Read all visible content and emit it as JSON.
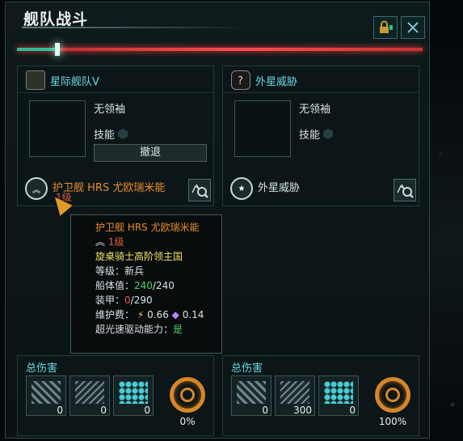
{
  "window": {
    "title": "舰队战斗"
  },
  "battle": {
    "progress_split": 0.1
  },
  "left": {
    "fleet_name": "星际舰队V",
    "leader": "无领袖",
    "skill_label": "技能",
    "retreat_label": "撤退",
    "ship_name": "护卫舰 HRS 尤欧瑞米能",
    "ship_level": "1级"
  },
  "right": {
    "fleet_name": "外星威胁",
    "leader": "无领袖",
    "skill_label": "技能",
    "ship_name": "外星威胁"
  },
  "tooltip": {
    "title": "护卫舰 HRS 尤欧瑞米能",
    "level": "1级",
    "empire": "旋桌骑士高阶领主国",
    "rank_label": "等级：",
    "rank_value": "新兵",
    "hull_label": "船体值：",
    "hull_current": "240",
    "hull_max": "/240",
    "armor_label": "装甲：",
    "armor_current": "0",
    "armor_max": "/290",
    "upkeep_label": "维护费：",
    "upkeep_energy": "0.66",
    "upkeep_alloy": "0.14",
    "ftl_label": "超光速驱动能力：",
    "ftl_value": "是"
  },
  "damage_left": {
    "title": "总伤害",
    "values": [
      "0",
      "0",
      "0"
    ],
    "percent": "0%"
  },
  "damage_right": {
    "title": "总伤害",
    "values": [
      "0",
      "300",
      "0"
    ],
    "percent": "100%"
  },
  "icons": {
    "lock": "lock-icon",
    "close": "close-icon",
    "magnify": "magnify-icon",
    "rank": "rank-chevron-icon"
  },
  "colors": {
    "accent": "#6ad8e0",
    "orange": "#e88b2c",
    "progress_ally": "#2bbd9a",
    "progress_enemy": "#ff4d4d"
  }
}
